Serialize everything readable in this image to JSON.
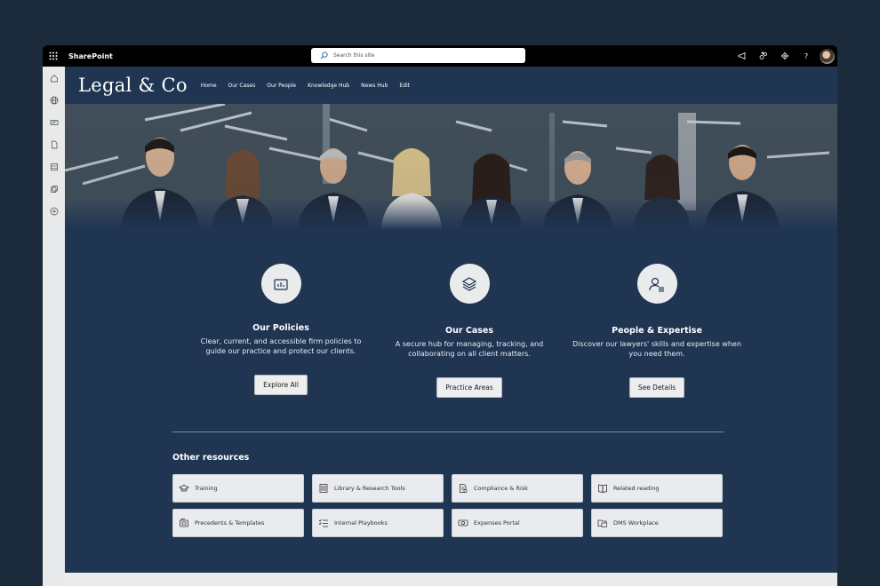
{
  "topbar": {
    "app_name": "SharePoint",
    "search_placeholder": "Search this site",
    "icons": [
      "waffle-icon",
      "search-icon",
      "megaphone-icon",
      "share-icon",
      "gear-icon",
      "help-icon"
    ]
  },
  "rail": {
    "icons": [
      "home-icon",
      "globe-icon",
      "news-icon",
      "file-icon",
      "list-icon",
      "copy-icon",
      "add-icon"
    ]
  },
  "header": {
    "logo": "Legal & Co",
    "nav": [
      "Home",
      "Our Cases",
      "Our People",
      "Knowledge Hub",
      "News Hub",
      "Edit"
    ]
  },
  "hero": {
    "description_icon": "team-photo"
  },
  "cards": [
    {
      "title": "Our Policies",
      "text": "Clear, current, and accessible firm policies to guide our practice and protect our clients.",
      "button": "Explore All",
      "icon": "chart-icon"
    },
    {
      "title": "Our Cases",
      "text": "A secure hub for managing, tracking, and collaborating on all client matters.",
      "button": "Practice Areas",
      "icon": "layers-icon"
    },
    {
      "title": "People & Expertise",
      "text": "Discover our lawyers' skills and expertise when you need them.",
      "button": "See Details",
      "icon": "person-list-icon"
    }
  ],
  "resources": {
    "title": "Other resources",
    "items": [
      {
        "label": "Training",
        "icon": "graduation-cap-icon"
      },
      {
        "label": "Library & Research Tools",
        "icon": "library-icon"
      },
      {
        "label": "Compliance & Risk",
        "icon": "document-check-icon"
      },
      {
        "label": "Related reading",
        "icon": "book-icon"
      },
      {
        "label": "Precedents & Templates",
        "icon": "template-icon"
      },
      {
        "label": "Internal Playbooks",
        "icon": "checklist-icon"
      },
      {
        "label": "Expenses Portal",
        "icon": "money-icon"
      },
      {
        "label": "DMS Workplace",
        "icon": "folder-icon"
      }
    ]
  },
  "colors": {
    "background": "#1c2b3c",
    "page": "#1f3552",
    "topbar": "#000000",
    "tile": "#e9ebee"
  }
}
